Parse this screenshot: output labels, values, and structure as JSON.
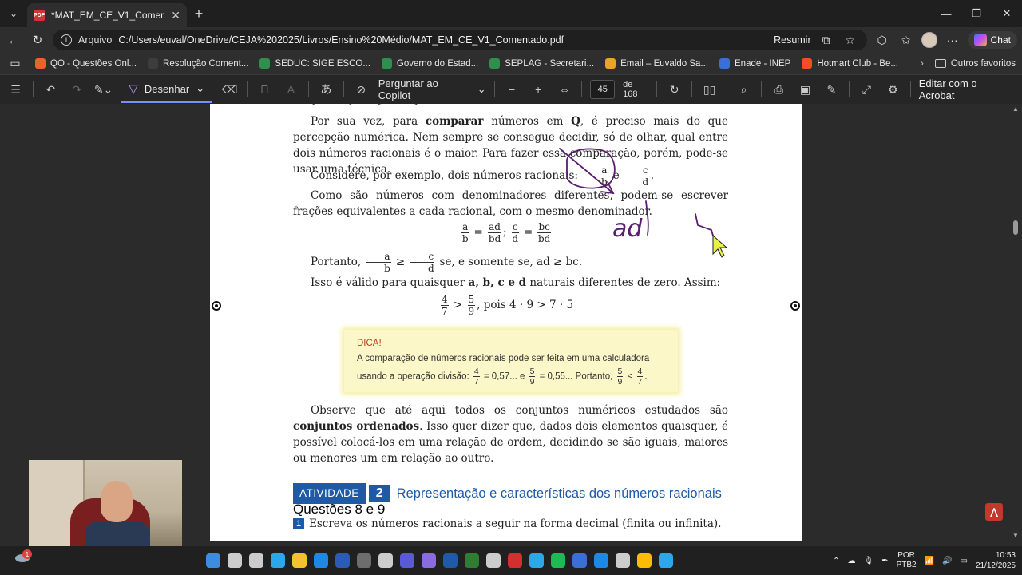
{
  "browser": {
    "tab_title": "*MAT_EM_CE_V1_Comentado.pdf",
    "address_label": "Arquivo",
    "url": "C:/Users/euval/OneDrive/CEJA%202025/Livros/Ensino%20Médio/MAT_EM_CE_V1_Comentado.pdf",
    "resumir": "Resumir",
    "chat": "Chat"
  },
  "favorites": [
    {
      "label": "QO - Questões Onl...",
      "color": "#e8642b"
    },
    {
      "label": "Resolução Coment...",
      "color": "#3d3d3d"
    },
    {
      "label": "SEDUC: SIGE ESCO...",
      "color": "#2f8f4e"
    },
    {
      "label": "Governo do Estad...",
      "color": "#2f8f4e"
    },
    {
      "label": "SEPLAG - Secretari...",
      "color": "#2f8f4e"
    },
    {
      "label": "Email – Euvaldo Sa...",
      "color": "#e9a527"
    },
    {
      "label": "Enade - INEP",
      "color": "#3b6fd4"
    },
    {
      "label": "Hotmart Club - Be...",
      "color": "#f04e23"
    }
  ],
  "favorites_other": "Outros favoritos",
  "pdf_toolbar": {
    "draw_label": "Desenhar",
    "copilot_label": "Perguntar ao Copilot",
    "page_current": "45",
    "page_total": "de 168",
    "edit_acrobat": "Editar com o Acrobat"
  },
  "doc": {
    "top_cut": "... < ... > ... < ... > ...",
    "para1_a": "Por sua vez, para ",
    "para1_b": "comparar",
    "para1_c": " números em ",
    "para1_q": "Q",
    "para1_d": ", é preciso mais do que percepção numérica. Nem sempre se consegue decidir, só de olhar, qual entre dois números racionais é o maior. Para fazer essa comparação, porém, pode-se usar uma técnica.",
    "para2": "Considere, por exemplo, dois números racionais: ",
    "para2_and": " e ",
    "para3": "Como são números com denominadores diferentes, podem-se escrever frações equivalentes a cada racional, com o mesmo denominador.",
    "eq1_ad": "ad",
    "eq1_bd": "bd",
    "eq1_bc": "bc",
    "fa": "a",
    "fb": "b",
    "fc": "c",
    "fd": "d",
    "portanto_a": "Portanto, ",
    "portanto_b": " se, e somente se, ad ≥ bc.",
    "isso_a": "Isso é válido para quaisquer ",
    "isso_vars": "a, b, c e d",
    "isso_b": " naturais diferentes de zero. Assim:",
    "ex_pois": ", pois 4 · 9 > 7 · 5",
    "n4": "4",
    "n7": "7",
    "n5": "5",
    "n9": "9",
    "dica_title": "DICA!",
    "dica_text1": "A comparação de números racionais pode ser feita em uma calculadora",
    "dica_text2a": "usando a operação divisão: ",
    "dica_text2b": " = 0,57... e ",
    "dica_text2c": " = 0,55... Portanto, ",
    "dica_text2d": ".",
    "obs_a": "Observe que até aqui todos os conjuntos numéricos estudados são ",
    "obs_b": "conjuntos ordenados",
    "obs_c": ". Isso quer dizer que, dados dois elementos quaisquer, é possível colocá-los em uma relação de ordem, decidindo se são iguais, maiores ou menores um em relação ao outro.",
    "atividade_label": "ATIVIDADE",
    "atividade_num": "2",
    "atividade_title": "Representação e características dos números racionais",
    "questoes": "Questões 8 e 9",
    "q1_num": "1",
    "q1_text": "Escreva os números racionais a seguir na forma decimal (finita ou infinita)."
  },
  "annotations": {
    "ink_text_ad": "ad"
  },
  "taskbar": {
    "notif_count": "1",
    "lang1": "POR",
    "lang2": "PTB2",
    "time": "10:53",
    "date": "21/12/2025"
  },
  "colors": {
    "accent": "#1f5aa6",
    "ink": "#5a1e6e",
    "dica_bg": "#fbf7c8"
  }
}
